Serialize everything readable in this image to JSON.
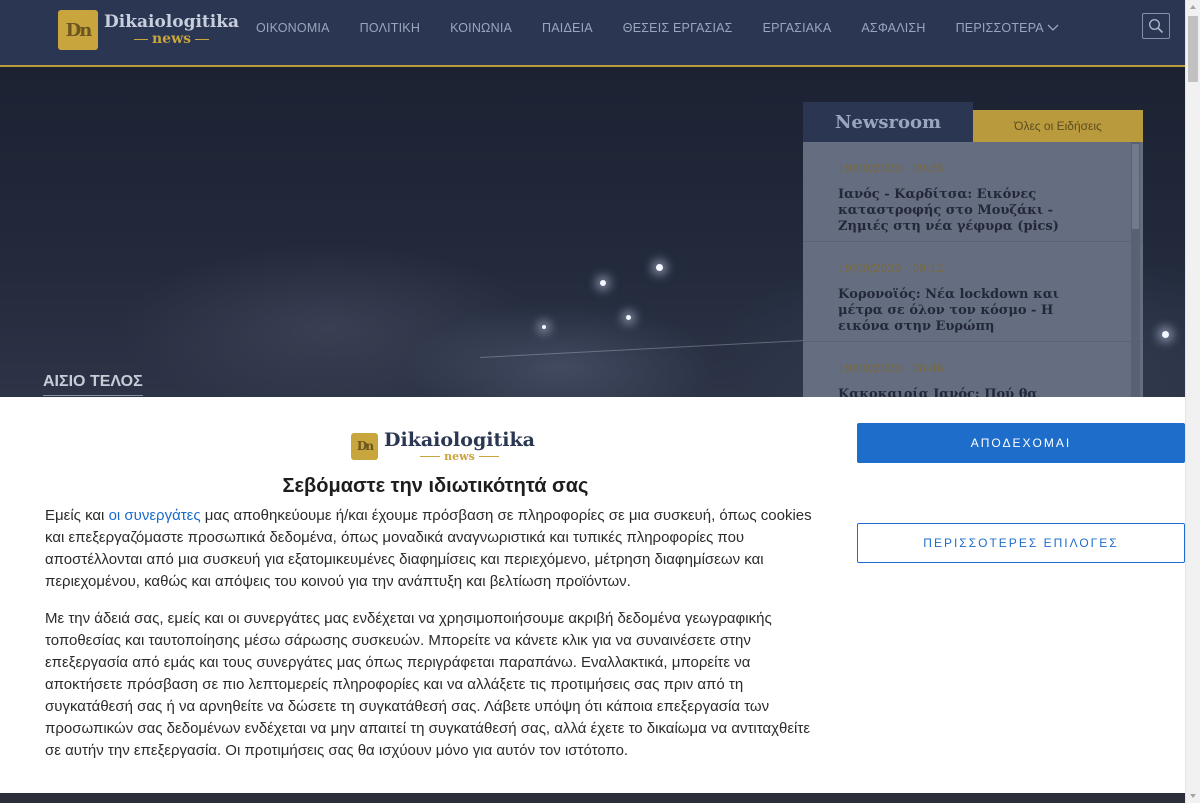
{
  "header": {
    "logo_main": "Dikaiologitika",
    "logo_sub": "news",
    "nav": [
      {
        "label": "ΟΙΚΟΝΟΜΙΑ"
      },
      {
        "label": "ΠΟΛΙΤΙΚΗ"
      },
      {
        "label": "ΚΟΙΝΩΝΙΑ"
      },
      {
        "label": "ΠΑΙΔΕΙΑ"
      },
      {
        "label": "ΘΕΣΕΙΣ ΕΡΓΑΣΙΑΣ"
      },
      {
        "label": "ΕΡΓΑΣΙΑΚΑ"
      },
      {
        "label": "ΑΣΦΑΛΙΣΗ"
      }
    ],
    "more_label": "ΠΕΡΙΣΣΟΤΕΡΑ",
    "search_icon": "search-icon"
  },
  "hero": {
    "category": "ΑΙΣΙΟ ΤΕΛΟΣ"
  },
  "newsroom": {
    "tab_title": "Newsroom",
    "tab_all": "Όλες οι Ειδήσεις",
    "items": [
      {
        "date": "19/09/2020 - 09:35",
        "title": "Ιανός - Καρδίτσα: Εικόνες καταστροφής στο Μουζάκι - Ζημιές στη νέα γέφυρα (pics)"
      },
      {
        "date": "19/09/2020 - 09:12",
        "title": "Κορονοϊός: Νέα lockdown και μέτρα σε όλον τον κόσμο - Η εικόνα στην Ευρώπη"
      },
      {
        "date": "19/09/2020 - 08:46",
        "title": "Κακοκαιρία Ιανός: Πού θα χτυπήσει ο"
      }
    ]
  },
  "consent": {
    "logo_main": "Dikaiologitika",
    "logo_sub": "news",
    "title": "Σεβόμαστε την ιδιωτικότητά σας",
    "p1_before": "Εμείς και ",
    "p1_link": "οι συνεργάτες",
    "p1_after": " μας αποθηκεύουμε ή/και έχουμε πρόσβαση σε πληροφορίες σε μια συσκευή, όπως cookies και επεξεργαζόμαστε προσωπικά δεδομένα, όπως μοναδικά αναγνωριστικά και τυπικές πληροφορίες που αποστέλλονται από μια συσκευή για εξατομικευμένες διαφημίσεις και περιεχόμενο, μέτρηση διαφημίσεων και περιεχομένου, καθώς και απόψεις του κοινού για την ανάπτυξη και βελτίωση προϊόντων.",
    "p2": "Με την άδειά σας, εμείς και οι συνεργάτες μας ενδέχεται να χρησιμοποιήσουμε ακριβή δεδομένα γεωγραφικής τοποθεσίας και ταυτοποίησης μέσω σάρωσης συσκευών. Μπορείτε να κάνετε κλικ για να συναινέσετε στην επεξεργασία από εμάς και τους συνεργάτες μας όπως περιγράφεται παραπάνω. Εναλλακτικά, μπορείτε να αποκτήσετε πρόσβαση σε πιο λεπτομερείς πληροφορίες και να αλλάξετε τις προτιμήσεις σας πριν από τη συγκατάθεσή σας ή να αρνηθείτε να δώσετε τη συγκατάθεσή σας. Λάβετε υπόψη ότι κάποια επεξεργασία των προσωπικών σας δεδομένων ενδέχεται να μην απαιτεί τη συγκατάθεσή σας, αλλά έχετε το δικαίωμα να αντιταχθείτε σε αυτήν την επεξεργασία. Οι προτιμήσεις σας θα ισχύουν μόνο για αυτόν τον ιστότοπο.",
    "accept_label": "ΑΠΟΔΕΧΟΜΑΙ",
    "more_options_label": "ΠΕΡΙΣΣΟΤΕΡΕΣ ΕΠΙΛΟΓΕΣ"
  },
  "colors": {
    "nav_bg": "#2b3652",
    "gold": "#b99a3c",
    "accent_blue": "#1f6dca"
  }
}
